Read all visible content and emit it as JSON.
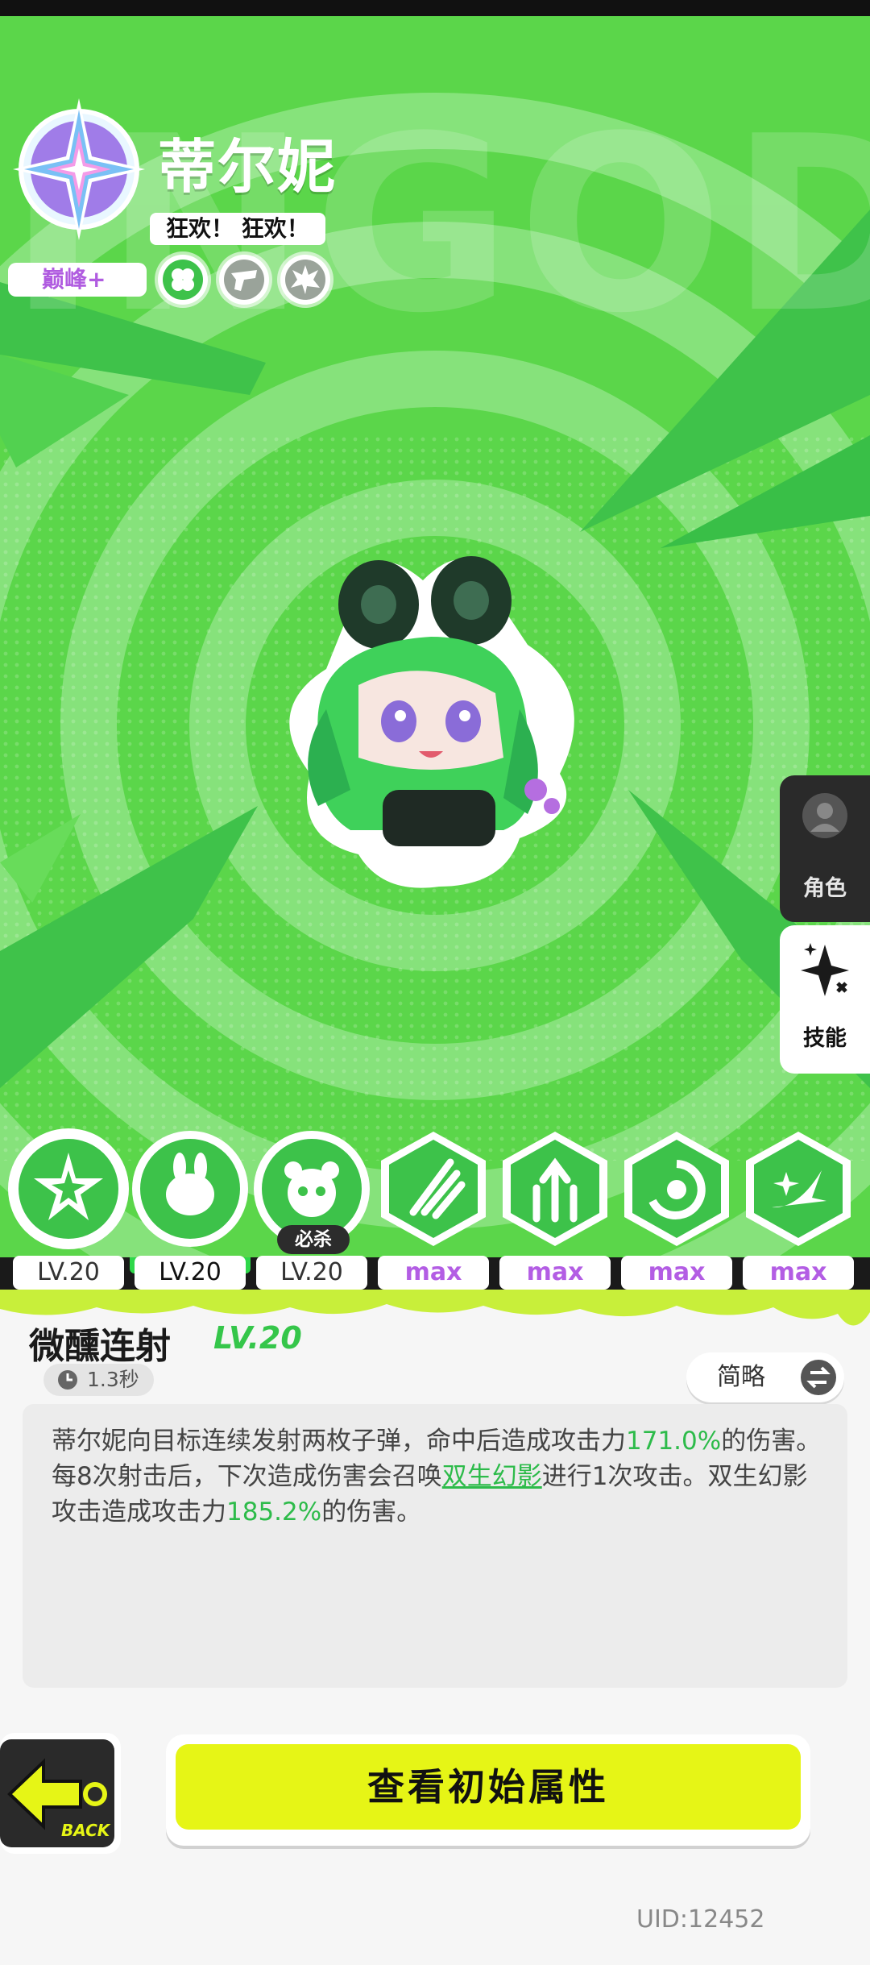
{
  "character": {
    "name": "蒂尔妮",
    "title": "狂欢！ 狂欢！",
    "rank": "巅峰+",
    "watermark": "INGOD",
    "traits": [
      "clover-icon",
      "gun-icon",
      "burst-icon"
    ]
  },
  "side_tabs": {
    "role_label": "角色",
    "skill_label": "技能"
  },
  "skills": [
    {
      "icon": "starburst-skill-icon",
      "level": "LV.20"
    },
    {
      "icon": "bunny-skill-icon",
      "level": "LV.20"
    },
    {
      "icon": "panda-skill-icon",
      "level": "LV.20",
      "tag": "必杀"
    },
    {
      "icon": "claw-skill-icon",
      "level": "max"
    },
    {
      "icon": "arrows-up-skill-icon",
      "level": "max"
    },
    {
      "icon": "swirl-skill-icon",
      "level": "max"
    },
    {
      "icon": "comet-skill-icon",
      "level": "max"
    }
  ],
  "selected_skill": {
    "name": "微醺连射",
    "level": "LV.20",
    "cooldown": "1.3秒",
    "brief_label": "简略",
    "desc_parts": {
      "p1": "蒂尔妮向目标连续发射两枚子弹，命中后造成攻击力",
      "v1": "171.0%",
      "p2": "的伤害。每8次射击后，下次造成伤害会召唤",
      "link": "双生幻影",
      "p3": "进行1次攻击。双生幻影攻击造成攻击力",
      "v2": "185.2%",
      "p4": "的伤害。"
    }
  },
  "footer": {
    "back_label": "BACK",
    "attr_button": "查看初始属性",
    "uid": "UID:12452"
  },
  "colors": {
    "bg_green": "#5bd64a",
    "accent_green": "#35c64a",
    "button_yellow": "#e6f516",
    "max_purple": "#b35de4"
  }
}
